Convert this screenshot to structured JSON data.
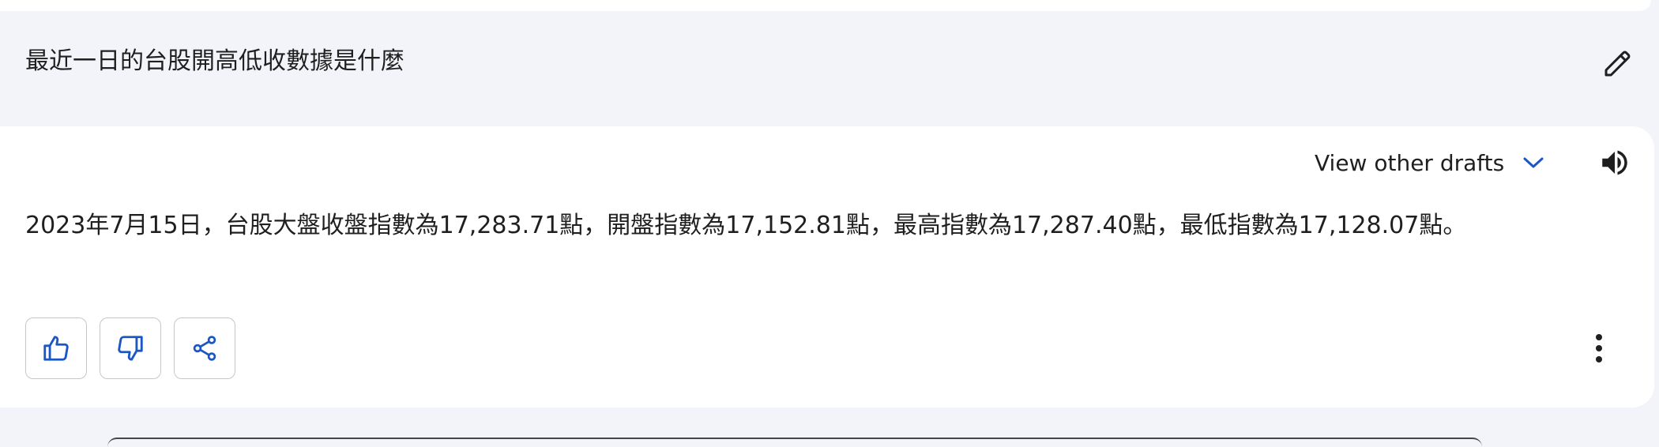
{
  "prompt": {
    "text": "最近一日的台股開高低收數據是什麼",
    "edit_icon": "pencil-icon"
  },
  "response": {
    "drafts_label": "View other drafts",
    "drafts_icon": "chevron-down-icon",
    "speaker_icon": "speaker-icon",
    "text": "2023年7月15日，台股大盤收盤指數為17,283.71點，開盤指數為17,152.81點，最高指數為17,287.40點，最低指數為17,128.07點。",
    "actions": [
      {
        "name": "thumbs-up",
        "icon": "thumbs-up-icon"
      },
      {
        "name": "thumbs-down",
        "icon": "thumbs-down-icon"
      },
      {
        "name": "share",
        "icon": "share-icon"
      }
    ],
    "more_icon": "more-vert-icon"
  },
  "colors": {
    "page_bg": "#f3f4f9",
    "card_bg": "#ffffff",
    "accent": "#1a56c4",
    "text": "#1f1f1f",
    "border": "#c7c7c7"
  }
}
